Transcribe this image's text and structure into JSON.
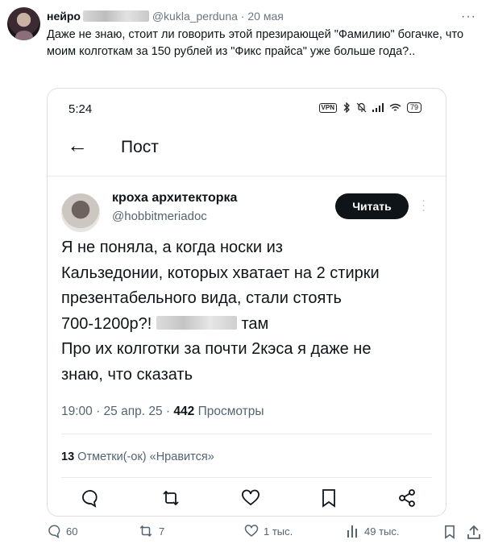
{
  "outer_tweet": {
    "author_name": "нейро",
    "handle": "@kukla_perduna",
    "date": "20 мая",
    "separator": "·",
    "text": "Даже не знаю, стоит ли говорить этой презирающей \"Фамилию\" богачке, что моим колготкам за 150 рублей из \"Фикс прайса\" уже больше года?..",
    "more_glyph": "···",
    "actions": {
      "replies": "60",
      "retweets": "7",
      "likes": "1 тыс.",
      "views": "49 тыс."
    }
  },
  "screenshot": {
    "status_bar": {
      "time": "5:24",
      "vpn": "VPN",
      "battery": "79"
    },
    "nav": {
      "back_glyph": "←",
      "title": "Пост"
    },
    "post": {
      "author_name": "кроха архитекторка",
      "handle": "@hobbitmeriadoc",
      "follow_label": "Читать",
      "lines": [
        "Я не поняла, а когда носки из",
        "Кальзедонии, которых хватает на 2 стирки",
        "презентабельного вида, стали стоять",
        "700-1200р?!",
        "там",
        "Про их колготки за почти 2кэса я даже не",
        "знаю, что сказать"
      ],
      "time": "19:00 · 25 апр. 25 ·",
      "views_count": "442",
      "views_label": "Просмотры",
      "likes_count": "13",
      "likes_label": "Отметки(-ок) «Нравится»"
    }
  },
  "icons": {
    "reply": "reply-icon",
    "retweet": "retweet-icon",
    "like": "heart-icon",
    "bookmark": "bookmark-icon",
    "share": "share-icon",
    "views": "views-icon"
  }
}
